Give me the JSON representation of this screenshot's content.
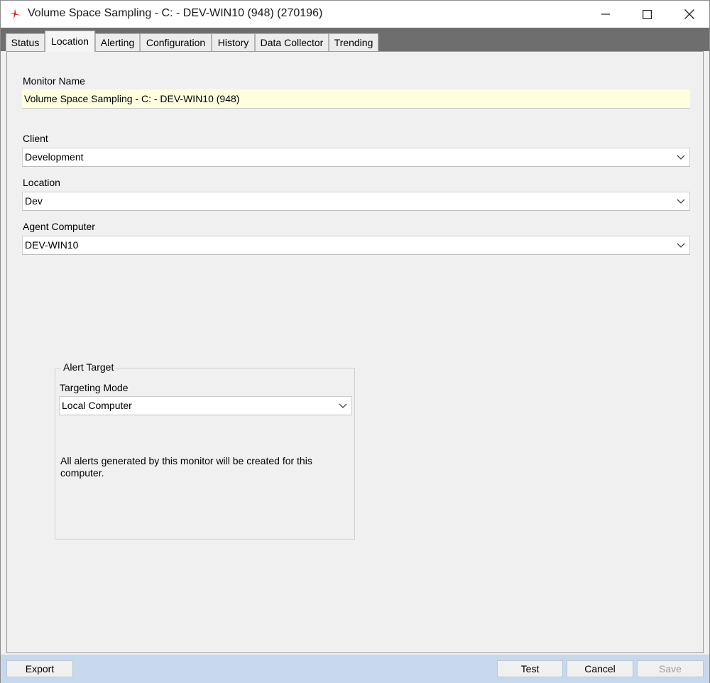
{
  "window": {
    "title": "Volume Space Sampling - C: - DEV-WIN10 (948) (270196)",
    "app_icon": "red-tripod-logo-icon"
  },
  "tabs": [
    {
      "label": "Status",
      "active": false
    },
    {
      "label": "Location",
      "active": true
    },
    {
      "label": "Alerting",
      "active": false
    },
    {
      "label": "Configuration",
      "active": false
    },
    {
      "label": "History",
      "active": false
    },
    {
      "label": "Data Collector",
      "active": false
    },
    {
      "label": "Trending",
      "active": false
    }
  ],
  "form": {
    "monitor_name_label": "Monitor Name",
    "monitor_name_value": "Volume Space Sampling - C: - DEV-WIN10 (948)",
    "client_label": "Client",
    "client_value": "Development",
    "location_label": "Location",
    "location_value": "Dev",
    "agent_label": "Agent Computer",
    "agent_value": "DEV-WIN10"
  },
  "alert_target": {
    "legend": "Alert Target",
    "mode_label": "Targeting Mode",
    "mode_value": "Local Computer",
    "description": "All alerts generated by this monitor will be created for this computer."
  },
  "buttons": {
    "export": "Export",
    "test": "Test",
    "cancel": "Cancel",
    "save": "Save"
  },
  "colors": {
    "tab_strip": "#6e6e6e",
    "bottom_bar": "#c8d8ec",
    "name_field_bg": "#ffffe0",
    "app_icon": "#d42020"
  }
}
